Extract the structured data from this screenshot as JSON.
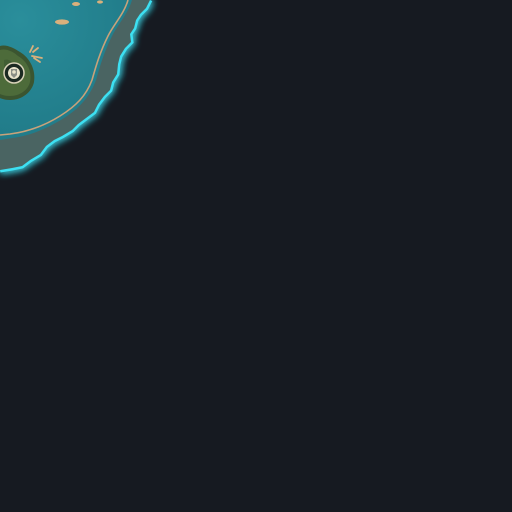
{
  "map": {
    "colors": {
      "background": "#161a21",
      "fog": "#161a21",
      "glow_border": "#3de0f2",
      "shelf": "#4a6462",
      "shelf_edge": "#c9a27a",
      "sea": "#2a8e9b",
      "sea_deep": "#1f7886",
      "island": "#4d6b3a",
      "island_dark": "#3b5530",
      "sand": "#d9b07c"
    },
    "icons": {
      "waypoint": "teleport-waypoint-icon",
      "islet": "sand-islet-icon",
      "coral": "coral-icon"
    },
    "waypoint_label": ""
  }
}
